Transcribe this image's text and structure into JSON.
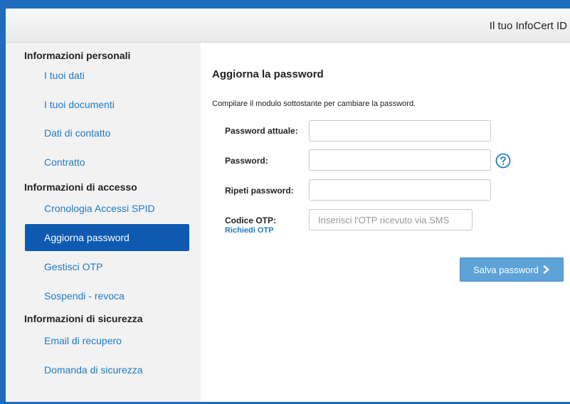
{
  "header": {
    "title": "Il tuo InfoCert ID"
  },
  "sidebar": {
    "sections": [
      {
        "title": "Informazioni personali",
        "items": [
          {
            "label": "I tuoi dati"
          },
          {
            "label": "I tuoi documenti"
          },
          {
            "label": "Dati di contatto"
          },
          {
            "label": "Contratto"
          }
        ]
      },
      {
        "title": "Informazioni di accesso",
        "items": [
          {
            "label": "Cronologia Accessi SPID"
          },
          {
            "label": "Aggiorna password",
            "active": true
          },
          {
            "label": "Gestisci OTP"
          },
          {
            "label": "Sospendi - revoca"
          }
        ]
      },
      {
        "title": "Informazioni di sicurezza",
        "items": [
          {
            "label": "Email di recupero"
          },
          {
            "label": "Domanda di sicurezza"
          }
        ]
      }
    ]
  },
  "main": {
    "title": "Aggiorna la password",
    "intro": "Compilare il modulo sottostante per cambiare la password.",
    "fields": {
      "current_password": {
        "label": "Password attuale:",
        "value": "",
        "placeholder": ""
      },
      "new_password": {
        "label": "Password:",
        "value": "",
        "placeholder": ""
      },
      "repeat_password": {
        "label": "Ripeti password:",
        "value": "",
        "placeholder": ""
      },
      "otp": {
        "label": "Codice OTP:",
        "value": "",
        "placeholder": "Inserisci l'OTP ricevuto via SMS"
      }
    },
    "request_otp_link": "Richiedi OTP",
    "help_icon": "question-circle-icon",
    "save_button": {
      "label": "Salva password",
      "icon": "chevron-right-icon"
    }
  },
  "colors": {
    "frame_blue": "#1d6cc0",
    "link_blue": "#1e7cc8",
    "active_nav": "#0e5ab0",
    "button": "#5da3d8"
  }
}
